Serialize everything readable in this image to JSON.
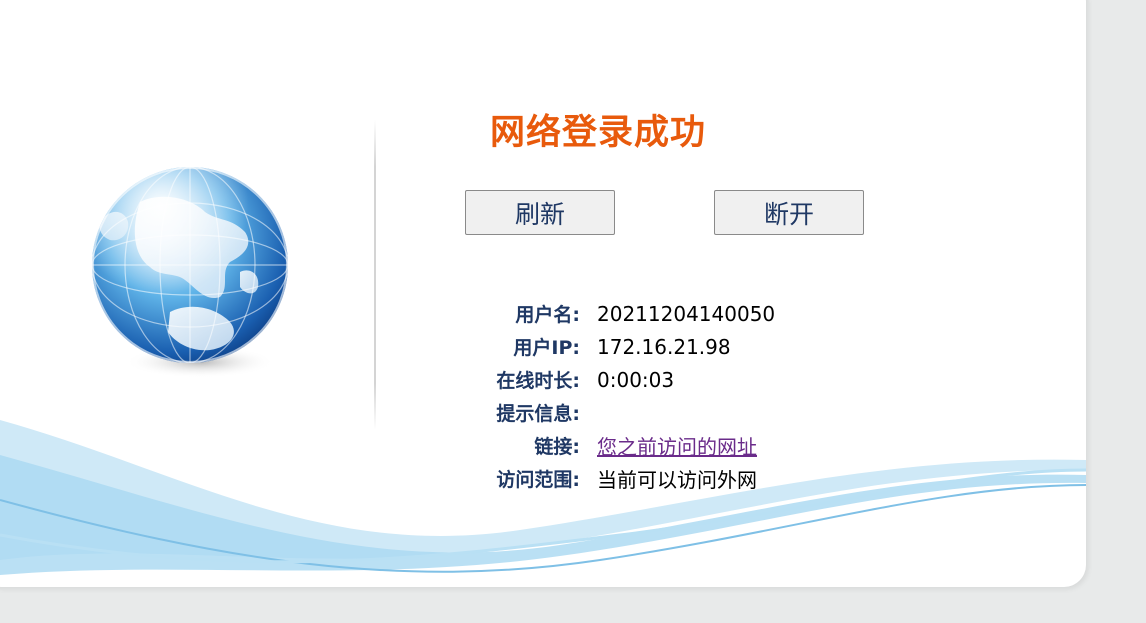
{
  "page": {
    "title": "网络登录成功"
  },
  "buttons": {
    "refresh_label": "刷新",
    "disconnect_label": "断开"
  },
  "info": {
    "rows": [
      {
        "label": "用户名:",
        "value": "20211204140050"
      },
      {
        "label": "用户IP:",
        "value": "172.16.21.98"
      },
      {
        "label": "在线时长:",
        "value": "0:00:03"
      },
      {
        "label": "提示信息:",
        "value": ""
      },
      {
        "label": "链接:",
        "value": "您之前访问的网址"
      },
      {
        "label": "访问范围:",
        "value": "当前可以访问外网"
      }
    ]
  },
  "colors": {
    "title": "#e85a0c",
    "label": "#1f3864",
    "link": "#6a2b8a",
    "wave": "#8fcbea"
  },
  "icons": {
    "logo": "globe-icon"
  }
}
